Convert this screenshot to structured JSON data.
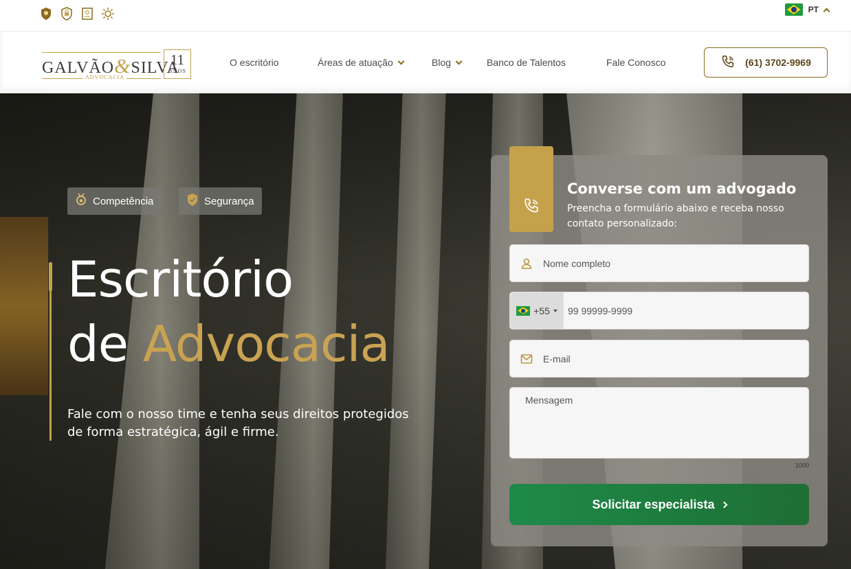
{
  "topbar": {
    "badges": [
      "shield-award-icon",
      "lock-shield-icon",
      "certificate-icon",
      "sun-icon"
    ],
    "language": "PT"
  },
  "header": {
    "logo": {
      "name_left": "GALVÃO",
      "ampersand": "&",
      "name_right": "SILVA",
      "subtitle": "ADVOCACIA",
      "years_number": "11",
      "years_label": "ANOS"
    },
    "nav": [
      {
        "label": "O escritório",
        "dropdown": false
      },
      {
        "label": "Áreas de atuação",
        "dropdown": true
      },
      {
        "label": "Blog",
        "dropdown": true
      },
      {
        "label": "Banco de Talentos",
        "dropdown": false
      },
      {
        "label": "Fale Conosco",
        "dropdown": false
      }
    ],
    "phone": "(61) 3702-9969"
  },
  "hero": {
    "pills": [
      {
        "label": "Competência",
        "icon": "medal-icon"
      },
      {
        "label": "Segurança",
        "icon": "shield-check-icon"
      }
    ],
    "title_line1": "Escritório",
    "title_line2_prefix": "de",
    "title_line2_highlight": "Advocacia",
    "lead": "Fale com o nosso time e tenha seus direitos protegidos de forma estratégica, ágil e firme.",
    "colors": {
      "accent": "#c4a14a",
      "submit": "#1e8a4a"
    }
  },
  "form": {
    "title": "Converse com um advogado",
    "subtitle": "Preencha o formulário abaixo e receba nosso contato personalizado:",
    "name_placeholder": "Nome completo",
    "country_code": "+55",
    "phone_placeholder": "99 99999-9999",
    "email_placeholder": "E-mail",
    "message_placeholder": "Mensagem",
    "message_max": "1000",
    "submit_label": "Solicitar especialista"
  }
}
